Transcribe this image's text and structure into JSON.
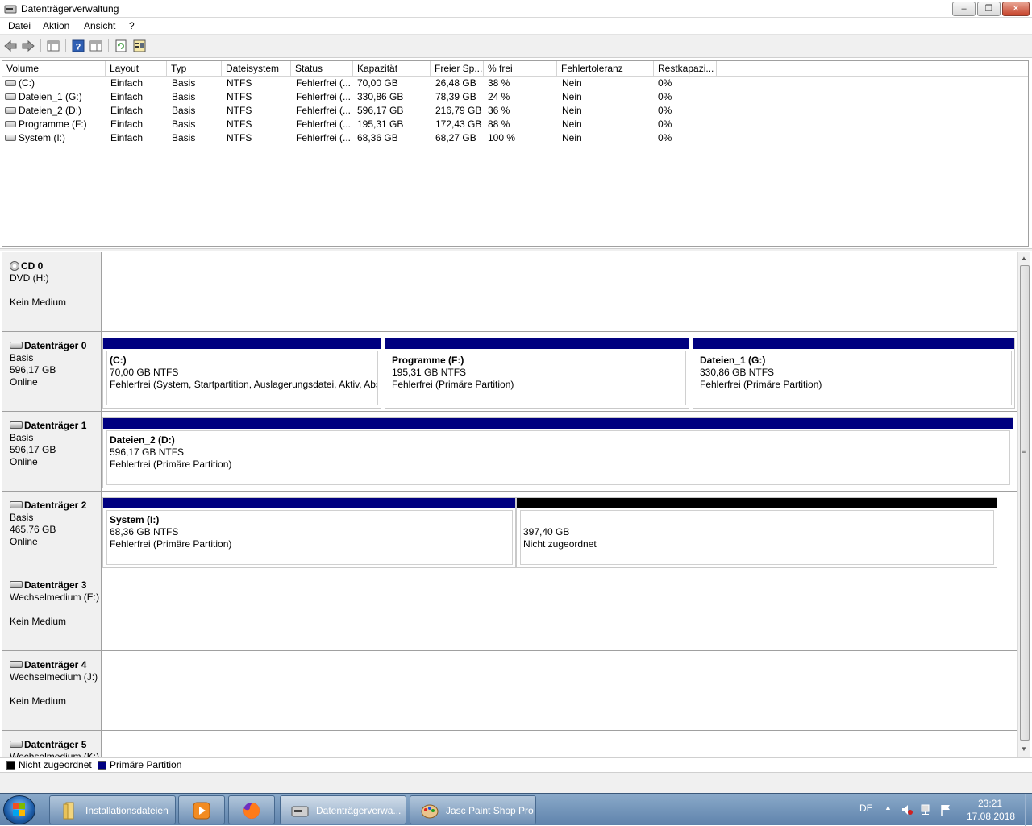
{
  "window": {
    "title": "Datenträgerverwaltung"
  },
  "menu": [
    "Datei",
    "Aktion",
    "Ansicht",
    "?"
  ],
  "volume_table": {
    "columns": [
      "Volume",
      "Layout",
      "Typ",
      "Dateisystem",
      "Status",
      "Kapazität",
      "Freier Sp...",
      "% frei",
      "Fehlertoleranz",
      "Restkapazi..."
    ],
    "rows": [
      [
        "(C:)",
        "Einfach",
        "Basis",
        "NTFS",
        "Fehlerfrei (...",
        "70,00 GB",
        "26,48 GB",
        "38 %",
        "Nein",
        "0%"
      ],
      [
        "Dateien_1 (G:)",
        "Einfach",
        "Basis",
        "NTFS",
        "Fehlerfrei (...",
        "330,86 GB",
        "78,39 GB",
        "24 %",
        "Nein",
        "0%"
      ],
      [
        "Dateien_2 (D:)",
        "Einfach",
        "Basis",
        "NTFS",
        "Fehlerfrei (...",
        "596,17 GB",
        "216,79 GB",
        "36 %",
        "Nein",
        "0%"
      ],
      [
        "Programme (F:)",
        "Einfach",
        "Basis",
        "NTFS",
        "Fehlerfrei (...",
        "195,31 GB",
        "172,43 GB",
        "88 %",
        "Nein",
        "0%"
      ],
      [
        "System (I:)",
        "Einfach",
        "Basis",
        "NTFS",
        "Fehlerfrei (...",
        "68,36 GB",
        "68,27 GB",
        "100 %",
        "Nein",
        "0%"
      ]
    ]
  },
  "disks": [
    {
      "name": "CD 0",
      "line1": "DVD (H:)",
      "line2": "",
      "line3": "Kein Medium",
      "icon": "cd-icon"
    },
    {
      "name": "Datenträger 0",
      "line1": "Basis",
      "line2": "596,17 GB",
      "line3": "Online",
      "icon": "disk-icon",
      "partitions": [
        {
          "title": "(C:)",
          "size": "70,00 GB NTFS",
          "status": "Fehlerfrei (System, Startpartition, Auslagerungsdatei, Aktiv, Absturzabbild, Primäre Partition)"
        },
        {
          "title": "Programme  (F:)",
          "size": "195,31 GB NTFS",
          "status": "Fehlerfrei (Primäre Partition)"
        },
        {
          "title": "Dateien_1  (G:)",
          "size": "330,86 GB NTFS",
          "status": "Fehlerfrei (Primäre Partition)"
        }
      ]
    },
    {
      "name": "Datenträger 1",
      "line1": "Basis",
      "line2": "596,17 GB",
      "line3": "Online",
      "icon": "disk-icon",
      "partitions": [
        {
          "title": "Dateien_2  (D:)",
          "size": "596,17 GB NTFS",
          "status": "Fehlerfrei (Primäre Partition)"
        }
      ]
    },
    {
      "name": "Datenträger 2",
      "line1": "Basis",
      "line2": "465,76 GB",
      "line3": "Online",
      "icon": "disk-icon",
      "partitions": [
        {
          "title": "System  (I:)",
          "size": "68,36 GB NTFS",
          "status": "Fehlerfrei (Primäre Partition)"
        },
        {
          "title": "",
          "size": "397,40 GB",
          "status": "Nicht zugeordnet"
        }
      ]
    },
    {
      "name": "Datenträger 3",
      "line1": "Wechselmedium (E:)",
      "line2": "",
      "line3": "Kein Medium",
      "icon": "removable-icon"
    },
    {
      "name": "Datenträger 4",
      "line1": "Wechselmedium (J:)",
      "line2": "",
      "line3": "Kein Medium",
      "icon": "removable-icon"
    },
    {
      "name": "Datenträger 5",
      "line1": "Wechselmedium (K:)",
      "line2": "",
      "line3": "",
      "icon": "removable-icon"
    }
  ],
  "legend": [
    {
      "label": "Nicht zugeordnet",
      "color": "#000000"
    },
    {
      "label": "Primäre Partition",
      "color": "#000080"
    }
  ],
  "taskbar": {
    "buttons": [
      "Installationsdateien",
      "",
      "",
      "Datenträgerverwa...",
      "Jasc Paint Shop Pro"
    ],
    "lang": "DE",
    "time": "23:21",
    "date": "17.08.2018"
  }
}
